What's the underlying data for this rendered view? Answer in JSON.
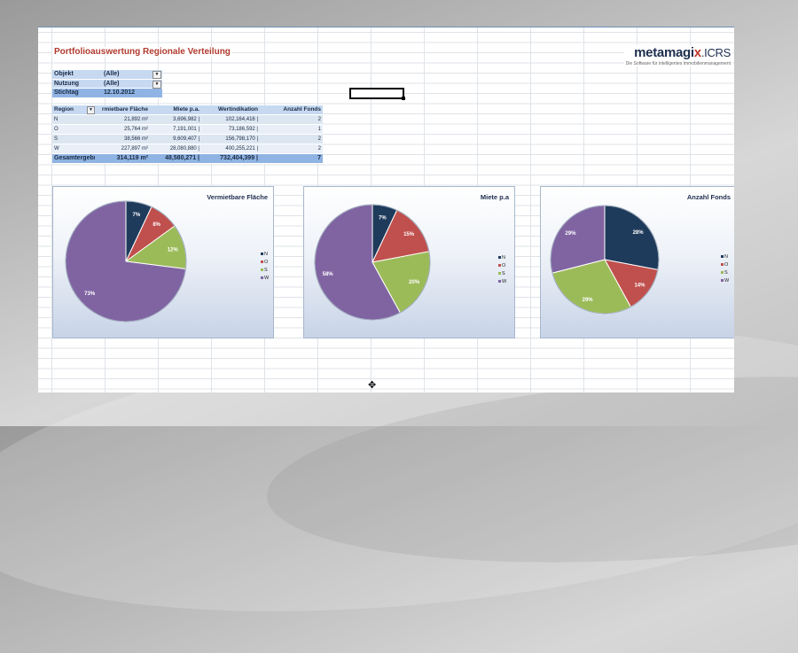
{
  "report": {
    "title": "Portfolioauswertung Regionale Verteilung"
  },
  "logo": {
    "main_a": "metamagi",
    "main_x": "x",
    "main_b": ".ICRS",
    "subtitle": "Die Software für intelligentes Immobilienmanagement"
  },
  "filters": [
    {
      "label": "Objekt",
      "value": "(Alle)",
      "dropdown": true
    },
    {
      "label": "Nutzung",
      "value": "(Alle)",
      "dropdown": true
    },
    {
      "label": "Stichtag",
      "value": "12.10.2012",
      "dropdown": false
    }
  ],
  "pivot": {
    "headers": [
      "Region",
      "rmietbare Fläche",
      "Miete p.a.",
      "Wertindikation",
      "Anzahl Fonds"
    ],
    "rows": [
      {
        "region": "N",
        "flaeche": "21,892 m²",
        "miete": "3,696,982 |",
        "wert": "102,164,416 |",
        "fonds": "2"
      },
      {
        "region": "O",
        "flaeche": "25,764 m²",
        "miete": "7,191,001 |",
        "wert": "73,186,592 |",
        "fonds": "1"
      },
      {
        "region": "S",
        "flaeche": "38,566 m²",
        "miete": "9,609,407 |",
        "wert": "156,798,170 |",
        "fonds": "2"
      },
      {
        "region": "W",
        "flaeche": "227,897 m²",
        "miete": "28,080,880 |",
        "wert": "400,255,221 |",
        "fonds": "2"
      }
    ],
    "total": {
      "label": "Gesamtergebni",
      "flaeche": "314,119 m²",
      "miete": "48,580,271 |",
      "wert": "732,404,399 |",
      "fonds": "7"
    }
  },
  "chart_data": [
    {
      "type": "pie",
      "title": "Vermietbare Fläche",
      "categories": [
        "N",
        "O",
        "S",
        "W"
      ],
      "values": [
        7,
        8,
        12,
        73
      ],
      "labels": [
        "7%",
        "8%",
        "12%",
        "73%"
      ],
      "colors": [
        "#1f3b5c",
        "#c0504d",
        "#9bbb59",
        "#8064a2"
      ],
      "legend": "right"
    },
    {
      "type": "pie",
      "title": "Miete p.a",
      "categories": [
        "N",
        "O",
        "S",
        "W"
      ],
      "values": [
        7,
        15,
        20,
        58
      ],
      "labels": [
        "7%",
        "15%",
        "20%",
        "58%"
      ],
      "colors": [
        "#1f3b5c",
        "#c0504d",
        "#9bbb59",
        "#8064a2"
      ],
      "legend": "right"
    },
    {
      "type": "pie",
      "title": "Anzahl  Fonds",
      "categories": [
        "N",
        "O",
        "S",
        "W"
      ],
      "values": [
        28,
        14,
        29,
        29
      ],
      "labels": [
        "28%",
        "14%",
        "29%",
        "29%"
      ],
      "colors": [
        "#1f3b5c",
        "#c0504d",
        "#9bbb59",
        "#8064a2"
      ],
      "legend": "right"
    }
  ],
  "icons": {
    "dropdown": "dropdown-arrow-icon",
    "cursor": "move-cursor-icon"
  }
}
